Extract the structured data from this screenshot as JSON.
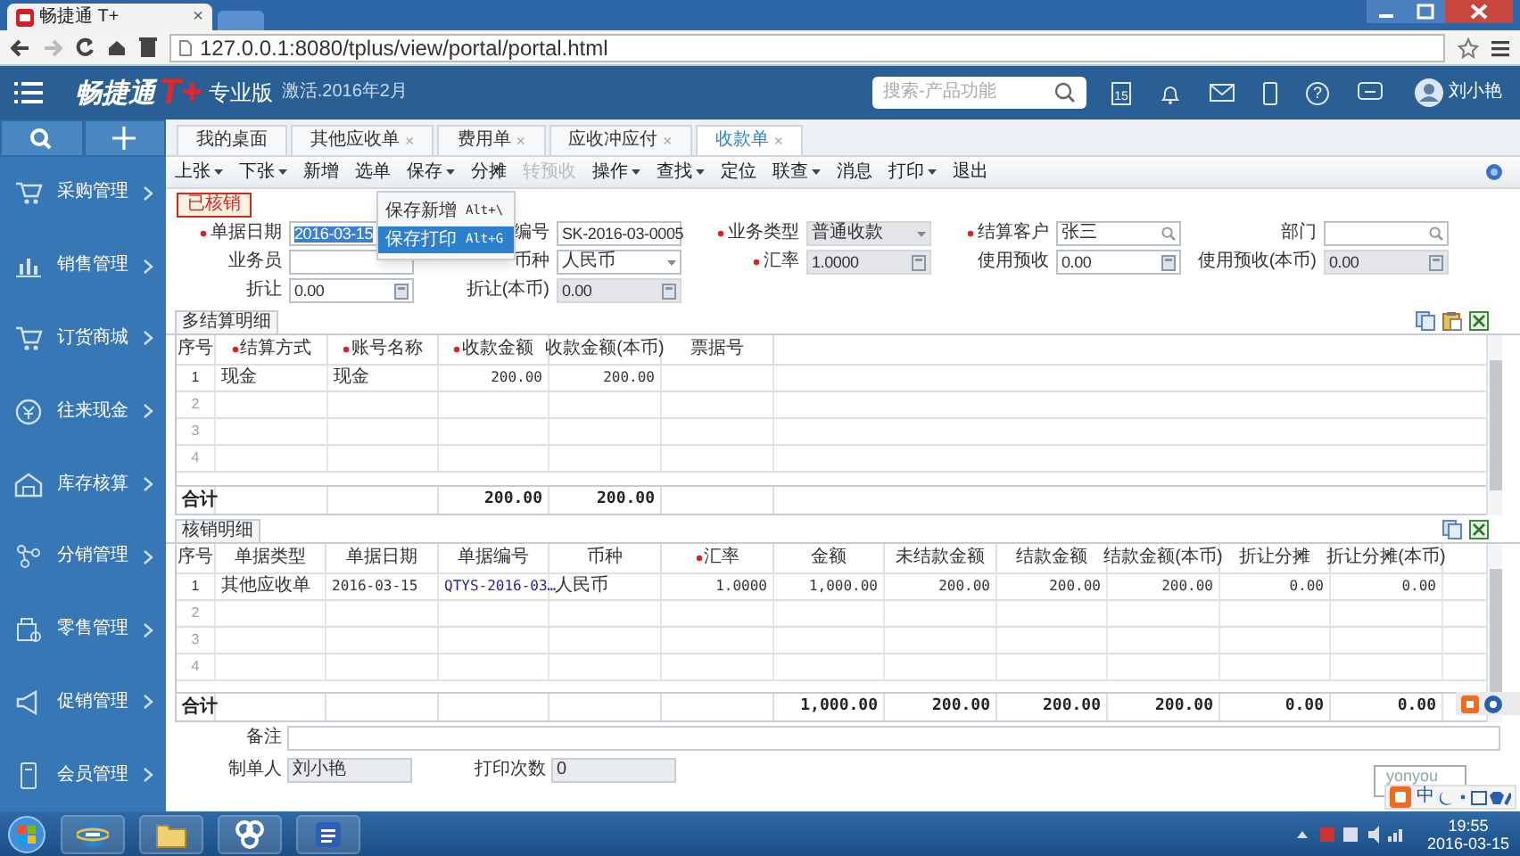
{
  "browser": {
    "tab_title": "畅捷通 T+",
    "tab_close": "×",
    "url": "127.0.0.1:8080/tplus/view/portal/portal.html"
  },
  "app_header": {
    "logo": "畅捷通",
    "logo_mark": "T+",
    "edition": "专业版",
    "activation": "激活.2016年2月",
    "search_placeholder": "搜索-产品功能",
    "calendar_day": "15",
    "help_glyph": "?",
    "user": "刘小艳"
  },
  "sidebar": {
    "items": [
      {
        "label": "采购管理"
      },
      {
        "label": "销售管理"
      },
      {
        "label": "订货商城"
      },
      {
        "label": "往来现金"
      },
      {
        "label": "库存核算"
      },
      {
        "label": "分销管理"
      },
      {
        "label": "零售管理"
      },
      {
        "label": "促销管理"
      },
      {
        "label": "会员管理"
      }
    ]
  },
  "tabs": [
    {
      "label": "我的桌面",
      "closable": false,
      "selected": false
    },
    {
      "label": "其他应收单",
      "closable": true,
      "selected": false
    },
    {
      "label": "费用单",
      "closable": true,
      "selected": false
    },
    {
      "label": "应收冲应付",
      "closable": true,
      "selected": false
    },
    {
      "label": "收款单",
      "closable": true,
      "selected": true
    }
  ],
  "tab_close": "×",
  "toolbar": [
    {
      "label": "上张",
      "dropdown": true,
      "disabled": false
    },
    {
      "label": "下张",
      "dropdown": true,
      "disabled": false
    },
    {
      "label": "新增",
      "dropdown": false,
      "disabled": false
    },
    {
      "label": "选单",
      "dropdown": false,
      "disabled": false
    },
    {
      "label": "保存",
      "dropdown": true,
      "disabled": false,
      "menu": [
        {
          "label": "保存新增",
          "shortcut": "Alt+\\",
          "selected": false
        },
        {
          "label": "保存打印",
          "shortcut": "Alt+G",
          "selected": true
        }
      ]
    },
    {
      "label": "分摊",
      "dropdown": false,
      "disabled": false
    },
    {
      "label": "转预收",
      "dropdown": false,
      "disabled": true
    },
    {
      "label": "操作",
      "dropdown": true,
      "disabled": false
    },
    {
      "label": "查找",
      "dropdown": true,
      "disabled": false
    },
    {
      "label": "定位",
      "dropdown": false,
      "disabled": false
    },
    {
      "label": "联查",
      "dropdown": true,
      "disabled": false
    },
    {
      "label": "消息",
      "dropdown": false,
      "disabled": false
    },
    {
      "label": "打印",
      "dropdown": true,
      "disabled": false
    },
    {
      "label": "退出",
      "dropdown": false,
      "disabled": false
    }
  ],
  "status_stamp": "已核销",
  "form_rows": [
    [
      {
        "label": "单据日期",
        "required": true,
        "value": "2016-03-15",
        "kind": "date",
        "readonly": false,
        "text_selected": true
      },
      {
        "label": "编号",
        "required": false,
        "value": "SK-2016-03-0005",
        "kind": "text",
        "readonly": false
      },
      {
        "label": "业务类型",
        "required": true,
        "value": "普通收款",
        "kind": "select",
        "readonly": true
      },
      {
        "label": "结算客户",
        "required": true,
        "value": "张三",
        "kind": "search",
        "readonly": false
      },
      {
        "label": "部门",
        "required": false,
        "kind": "search",
        "readonly": false
      }
    ],
    [
      {
        "label": "业务员",
        "required": false,
        "kind": "text",
        "readonly": false
      },
      {
        "label": "币种",
        "required": false,
        "value": "人民币",
        "kind": "select",
        "readonly": false
      },
      {
        "label": "汇率",
        "required": true,
        "value": "1.0000",
        "kind": "number",
        "readonly": true
      },
      {
        "label": "使用预收",
        "required": false,
        "value": "0.00",
        "kind": "number",
        "readonly": false
      },
      {
        "label": "使用预收(本币)",
        "required": false,
        "value": "0.00",
        "kind": "number",
        "readonly": true
      }
    ],
    [
      {
        "label": "折让",
        "required": false,
        "value": "0.00",
        "kind": "number",
        "readonly": false
      },
      {
        "label": "折让(本币)",
        "required": false,
        "value": "0.00",
        "kind": "number",
        "readonly": true
      }
    ]
  ],
  "detail_tables": [
    {
      "title": "多结算明细",
      "columns": [
        {
          "label": "序号",
          "required": false
        },
        {
          "label": "结算方式",
          "required": true,
          "numeric": false
        },
        {
          "label": "账号名称",
          "required": true,
          "numeric": false
        },
        {
          "label": "收款金额",
          "required": true,
          "numeric": true,
          "total": "200.00"
        },
        {
          "label": "收款金额(本币)",
          "required": false,
          "numeric": true,
          "total": "200.00"
        },
        {
          "label": "票据号",
          "required": false
        }
      ],
      "rows": [
        {
          "no": "1",
          "cells": [
            "现金",
            "现金",
            "200.00",
            "200.00"
          ]
        },
        {
          "no": "2"
        },
        {
          "no": "3"
        },
        {
          "no": "4"
        }
      ],
      "total_label": "合计"
    },
    {
      "title": "核销明细",
      "columns": [
        {
          "label": "序号",
          "required": false
        },
        {
          "label": "单据类型",
          "required": false,
          "numeric": false
        },
        {
          "label": "单据日期",
          "required": false,
          "numeric": false
        },
        {
          "label": "单据编号",
          "required": false,
          "numeric": false,
          "kind": "link"
        },
        {
          "label": "币种",
          "required": false,
          "numeric": false
        },
        {
          "label": "汇率",
          "required": true,
          "numeric": true
        },
        {
          "label": "金额",
          "required": false,
          "numeric": true,
          "total": "1,000.00"
        },
        {
          "label": "未结款金额",
          "required": false,
          "numeric": true,
          "total": "200.00"
        },
        {
          "label": "结款金额",
          "required": false,
          "numeric": true,
          "total": "200.00"
        },
        {
          "label": "结款金额(本币)",
          "required": false,
          "numeric": true,
          "total": "200.00"
        },
        {
          "label": "折让分摊",
          "required": false,
          "numeric": true,
          "total": "0.00"
        },
        {
          "label": "折让分摊(本币)",
          "required": false,
          "numeric": true,
          "total": "0.00"
        }
      ],
      "rows": [
        {
          "no": "1",
          "cells": [
            "其他应收单",
            "2016-03-15",
            "QTYS-2016-03…",
            "人民币",
            "1.0000",
            "1,000.00",
            "200.00",
            "200.00",
            "200.00",
            "0.00",
            "0.00"
          ]
        },
        {
          "no": "2"
        },
        {
          "no": "3"
        },
        {
          "no": "4"
        }
      ],
      "total_label": "合计"
    }
  ],
  "footer_fields": [
    {
      "label": "备注",
      "kind": "wide",
      "readonly": false
    },
    {
      "label": "制单人",
      "value": "刘小艳",
      "kind": "short",
      "readonly": true
    },
    {
      "label": "打印次数",
      "value": "0",
      "kind": "short",
      "readonly": true
    }
  ],
  "ime": {
    "mode": "中"
  },
  "brand_box": "yonyou",
  "taskbar": {
    "time": "19:55",
    "date": "2016-03-15"
  }
}
